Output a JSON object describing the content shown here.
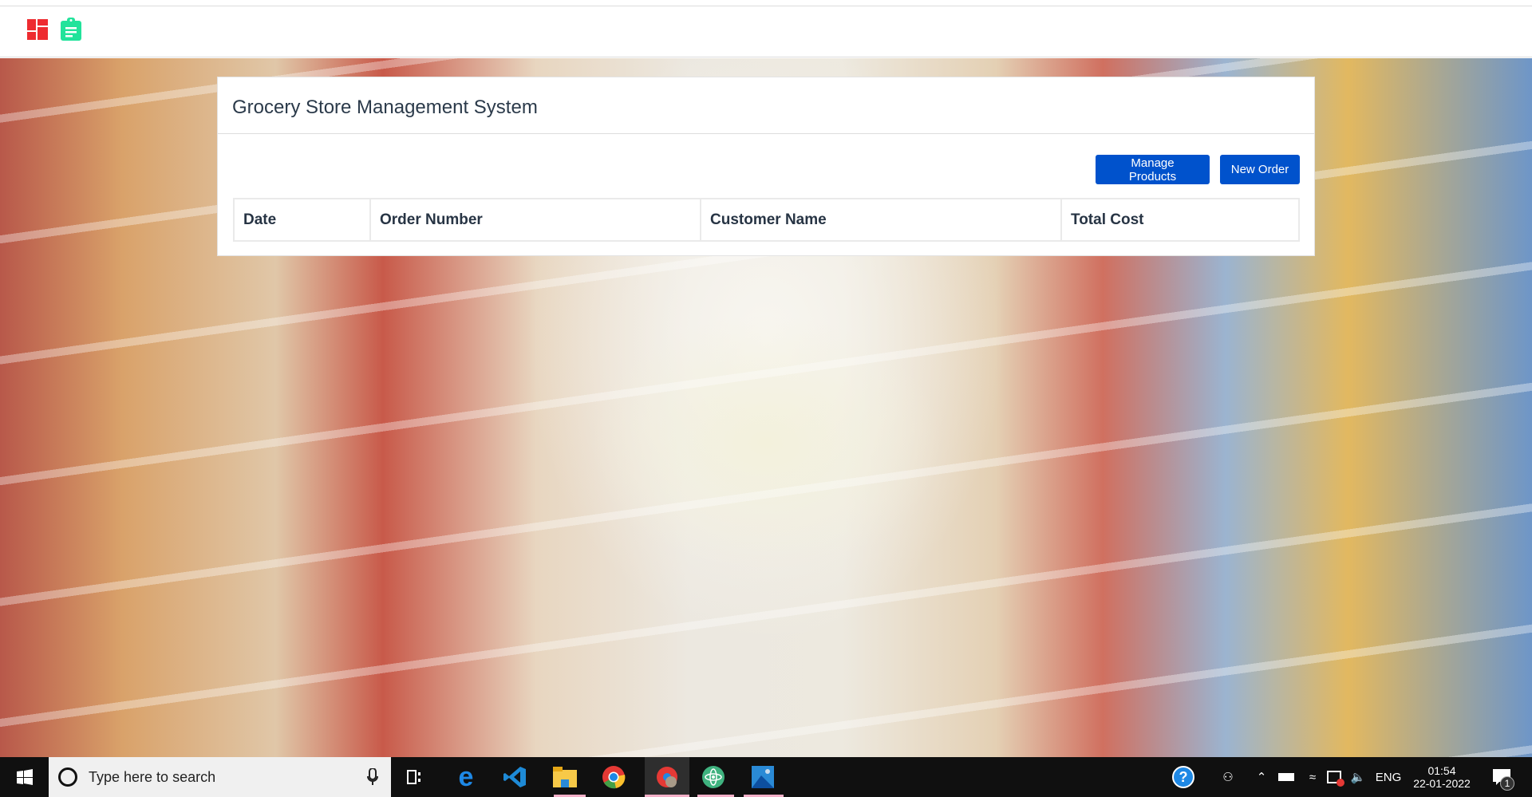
{
  "nav": {
    "icons": [
      "dashboard-icon",
      "clipboard-icon"
    ],
    "colors": {
      "dashboard": "#ee2b30",
      "clipboard": "#22e39b"
    }
  },
  "card": {
    "title": "Grocery Store Management System",
    "buttons": {
      "manage_products": "Manage Products",
      "new_order": "New Order"
    },
    "table": {
      "columns": [
        "Date",
        "Order Number",
        "Customer Name",
        "Total Cost"
      ],
      "rows": []
    }
  },
  "taskbar": {
    "search_placeholder": "Type here to search",
    "language": "ENG",
    "time": "01:54",
    "date": "22-01-2022",
    "notification_count": "1",
    "apps": [
      "task-view",
      "edge",
      "vscode",
      "file-explorer",
      "chrome",
      "chrome-profile",
      "atom",
      "photos"
    ]
  },
  "colors": {
    "primary": "#0052cc"
  }
}
